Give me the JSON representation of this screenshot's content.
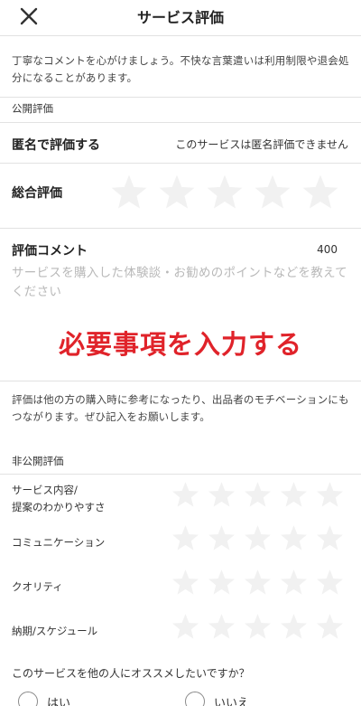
{
  "header": {
    "title": "サービス評価",
    "close_icon": "close-icon"
  },
  "notice": "丁寧なコメントを心がけましょう。不快な言葉遣いは利用制限や退会処分になることがあります。",
  "public_review": {
    "section_label": "公開評価",
    "anonymous_label": "匿名で評価する",
    "anonymous_note": "このサービスは匿名評価できません",
    "overall_label": "総合評価",
    "overall_rating": 0,
    "overall_max": 5
  },
  "comment": {
    "label": "評価コメント",
    "count": "400",
    "value": "",
    "placeholder": "サービスを購入した体験談・お勧めのポイントなどを教えてください"
  },
  "overlay_text": "必要事項を入力する",
  "encourage_text": "評価は他の方の購入時に参考になったり、出品者のモチベーションにもつながります。ぜひ記入をお願いします。",
  "private_review": {
    "section_label": "非公開評価",
    "criteria": [
      {
        "label_lines": [
          "サービス内容/",
          "提案のわかりやすさ"
        ],
        "rating": 0,
        "max": 5
      },
      {
        "label_lines": [
          "コミュニケーション"
        ],
        "rating": 0,
        "max": 5
      },
      {
        "label_lines": [
          "クオリティ"
        ],
        "rating": 0,
        "max": 5
      },
      {
        "label_lines": [
          "納期/スケジュール"
        ],
        "rating": 0,
        "max": 5
      }
    ]
  },
  "recommend": {
    "question": "このサービスを他の人にオススメしたいですか？",
    "options": [
      {
        "label": "はい",
        "selected": false
      },
      {
        "label": "いいえ",
        "selected": false
      }
    ]
  },
  "colors": {
    "star_empty": "#f1f1f1",
    "overlay_red": "#e0232a",
    "divider": "#e2e2e2"
  }
}
